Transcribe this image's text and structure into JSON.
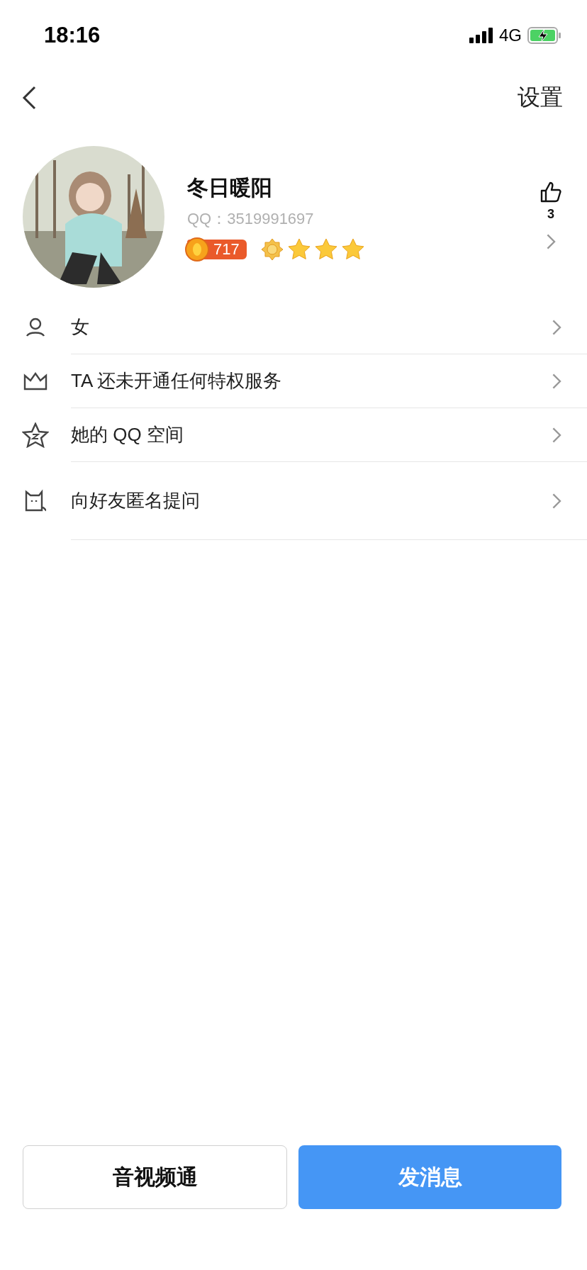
{
  "status_bar": {
    "time": "18:16",
    "network": "4G"
  },
  "nav": {
    "settings": "设置"
  },
  "profile": {
    "name": "冬日暖阳",
    "qq": "QQ：3519991697",
    "coins": "717",
    "likes": "3",
    "level_badges": [
      {
        "kind": "sun"
      },
      {
        "kind": "star"
      },
      {
        "kind": "star"
      },
      {
        "kind": "star"
      }
    ]
  },
  "rows": [
    {
      "kind": "person",
      "label": "女"
    },
    {
      "kind": "crown",
      "label": "TA 还未开通任何特权服务"
    },
    {
      "kind": "zone",
      "label": "她的 QQ 空间"
    },
    {
      "kind": "cat",
      "label": "向好友匿名提问"
    }
  ],
  "buttons": [
    {
      "label": "音视频通",
      "primary": false
    },
    {
      "label": "发消息",
      "primary": true
    }
  ]
}
